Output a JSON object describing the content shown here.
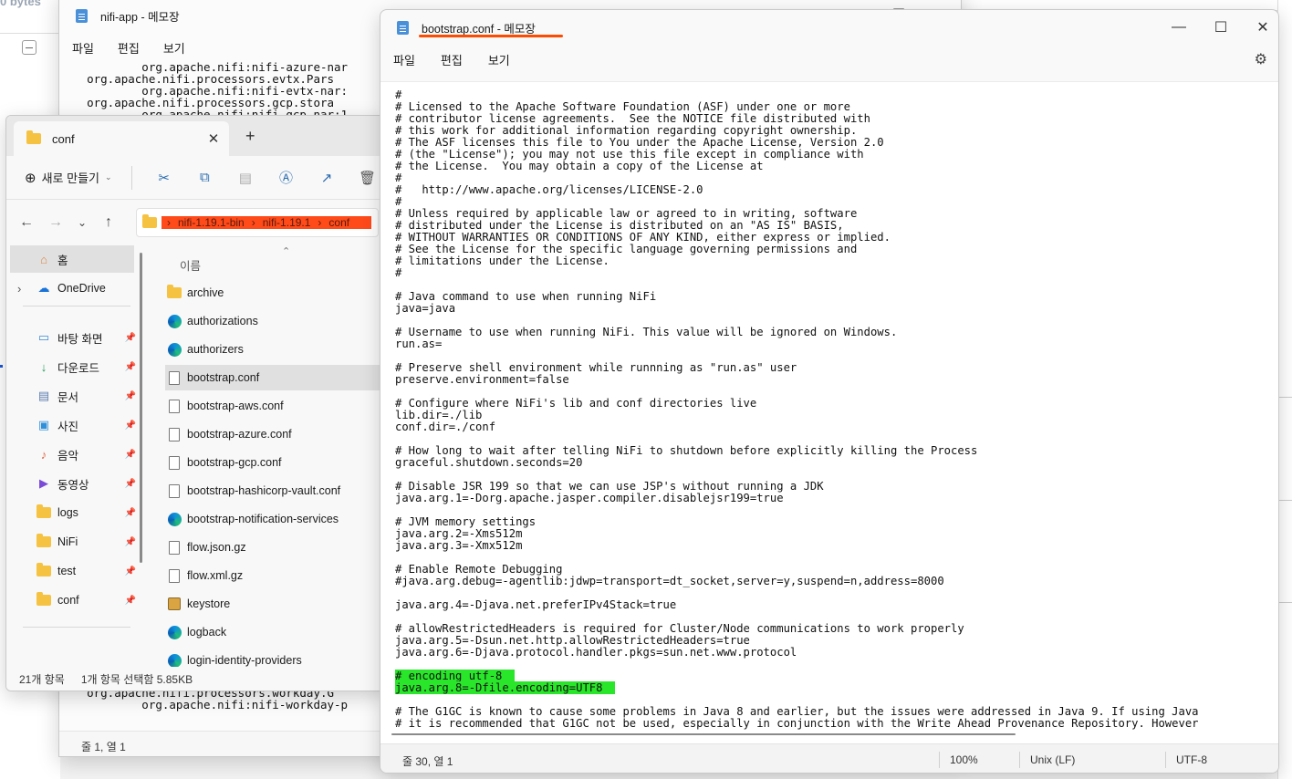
{
  "background": {
    "left_text": "0 bytes"
  },
  "nifi_window": {
    "title": "nifi-app - 메모장",
    "menu": [
      "파일",
      "편집",
      "보기"
    ],
    "top_lines": [
      "            org.apache.nifi:nifi-azure-nar",
      "    org.apache.nifi.processors.evtx.Pars",
      "            org.apache.nifi:nifi-evtx-nar:",
      "    org.apache.nifi.processors.gcp.stora",
      "            org.apache.nifi:nifi-gcp-nar:1"
    ],
    "bottom_lines": [
      "    org.apache.nifi.processors.workday.G",
      "            org.apache.nifi:nifi-workday-p"
    ],
    "status": "줄 1, 열 1"
  },
  "explorer": {
    "tab_title": "conf",
    "new_button": "새로 만들기",
    "breadcrumbs": [
      "nifi-1.19.1-bin",
      "nifi-1.19.1",
      "conf"
    ],
    "column_header": "이름",
    "nav": [
      {
        "label": "홈",
        "icon": "home-icon"
      },
      {
        "label": "OneDrive",
        "icon": "cloud-icon"
      },
      {
        "label": "바탕 화면",
        "icon": "desktop-icon"
      },
      {
        "label": "다운로드",
        "icon": "download-icon"
      },
      {
        "label": "문서",
        "icon": "document-icon"
      },
      {
        "label": "사진",
        "icon": "picture-icon"
      },
      {
        "label": "음악",
        "icon": "music-icon"
      },
      {
        "label": "동영상",
        "icon": "video-icon"
      },
      {
        "label": "logs",
        "icon": "folder-icon"
      },
      {
        "label": "NiFi",
        "icon": "folder-icon"
      },
      {
        "label": "test",
        "icon": "folder-icon"
      },
      {
        "label": "conf",
        "icon": "folder-icon"
      }
    ],
    "files": [
      {
        "name": "archive",
        "icon": "folder-icon"
      },
      {
        "name": "authorizations",
        "icon": "edge-icon"
      },
      {
        "name": "authorizers",
        "icon": "edge-icon"
      },
      {
        "name": "bootstrap.conf",
        "icon": "file-icon",
        "selected": true
      },
      {
        "name": "bootstrap-aws.conf",
        "icon": "file-icon"
      },
      {
        "name": "bootstrap-azure.conf",
        "icon": "file-icon"
      },
      {
        "name": "bootstrap-gcp.conf",
        "icon": "file-icon"
      },
      {
        "name": "bootstrap-hashicorp-vault.conf",
        "icon": "file-icon"
      },
      {
        "name": "bootstrap-notification-services",
        "icon": "edge-icon"
      },
      {
        "name": "flow.json.gz",
        "icon": "file-icon"
      },
      {
        "name": "flow.xml.gz",
        "icon": "file-icon"
      },
      {
        "name": "keystore",
        "icon": "certificate-icon"
      },
      {
        "name": "logback",
        "icon": "edge-icon"
      },
      {
        "name": "login-identity-providers",
        "icon": "edge-icon"
      }
    ],
    "status_count": "21개 항목",
    "status_selected": "1개 항목 선택함 5.85KB"
  },
  "notepad": {
    "title": "bootstrap.conf - 메모장",
    "menu": [
      "파일",
      "편집",
      "보기"
    ],
    "lines": [
      "#",
      "# Licensed to the Apache Software Foundation (ASF) under one or more",
      "# contributor license agreements.  See the NOTICE file distributed with",
      "# this work for additional information regarding copyright ownership.",
      "# The ASF licenses this file to You under the Apache License, Version 2.0",
      "# (the \"License\"); you may not use this file except in compliance with",
      "# the License.  You may obtain a copy of the License at",
      "#",
      "#   http://www.apache.org/licenses/LICENSE-2.0",
      "#",
      "# Unless required by applicable law or agreed to in writing, software",
      "# distributed under the License is distributed on an \"AS IS\" BASIS,",
      "# WITHOUT WARRANTIES OR CONDITIONS OF ANY KIND, either express or implied.",
      "# See the License for the specific language governing permissions and",
      "# limitations under the License.",
      "#",
      "",
      "# Java command to use when running NiFi",
      "java=java",
      "",
      "# Username to use when running NiFi. This value will be ignored on Windows.",
      "run.as=",
      "",
      "# Preserve shell environment while runnning as \"run.as\" user",
      "preserve.environment=false",
      "",
      "# Configure where NiFi's lib and conf directories live",
      "lib.dir=./lib",
      "conf.dir=./conf",
      "",
      "# How long to wait after telling NiFi to shutdown before explicitly killing the Process",
      "graceful.shutdown.seconds=20",
      "",
      "# Disable JSR 199 so that we can use JSP's without running a JDK",
      "java.arg.1=-Dorg.apache.jasper.compiler.disablejsr199=true",
      "",
      "# JVM memory settings",
      "java.arg.2=-Xms512m",
      "java.arg.3=-Xmx512m",
      "",
      "# Enable Remote Debugging",
      "#java.arg.debug=-agentlib:jdwp=transport=dt_socket,server=y,suspend=n,address=8000",
      "",
      "java.arg.4=-Djava.net.preferIPv4Stack=true",
      "",
      "# allowRestrictedHeaders is required for Cluster/Node communications to work properly",
      "java.arg.5=-Dsun.net.http.allowRestrictedHeaders=true",
      "java.arg.6=-Djava.protocol.handler.pkgs=sun.net.www.protocol",
      "",
      "# encoding utf-8",
      "java.arg.8=-Dfile.encoding=UTF8",
      "",
      "# The G1GC is known to cause some problems in Java 8 and earlier, but the issues were addressed in Java 9. If using Java",
      "# it is recommended that G1GC not be used, especially in conjunction with the Write Ahead Provenance Repository. However"
    ],
    "highlight_lines": [
      49,
      50
    ],
    "highlight_color": "#29e62a",
    "status": {
      "position": "줄 30, 열 1",
      "zoom": "100%",
      "line_ending": "Unix (LF)",
      "encoding": "UTF-8"
    }
  }
}
